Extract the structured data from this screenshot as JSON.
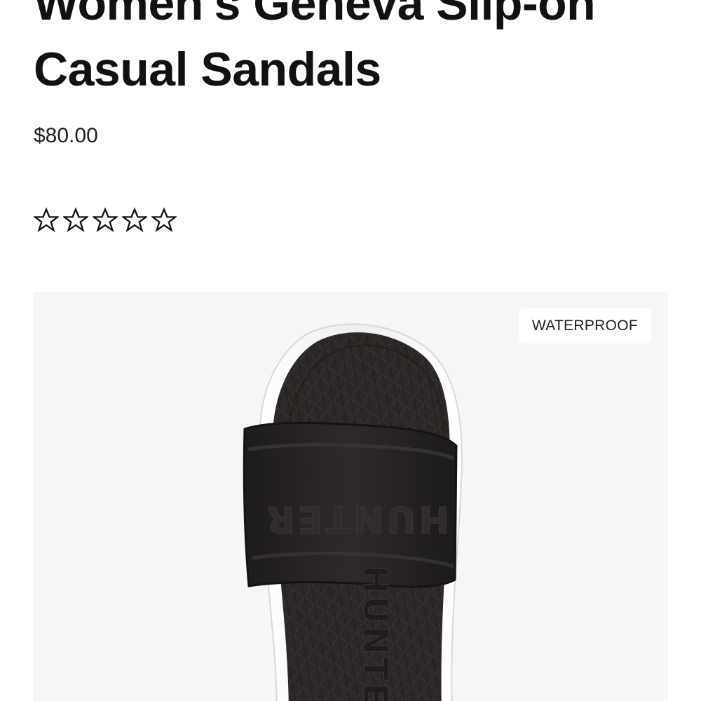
{
  "product": {
    "title": "Women's Geneva Slip-on Casual Sandals",
    "price": "$80.00",
    "rating": {
      "value": 0,
      "max": 5,
      "icon": "star-outline-icon"
    }
  },
  "gallery": {
    "badge": "WATERPROOF",
    "image": "black-slide-sandal",
    "strap_logo": "HUNTER",
    "footbed_logo": "HUNTER"
  },
  "colors": {
    "background": "#ffffff",
    "gallery_background": "#f6f6f6",
    "text": "#111111",
    "sandal": "#252322"
  }
}
